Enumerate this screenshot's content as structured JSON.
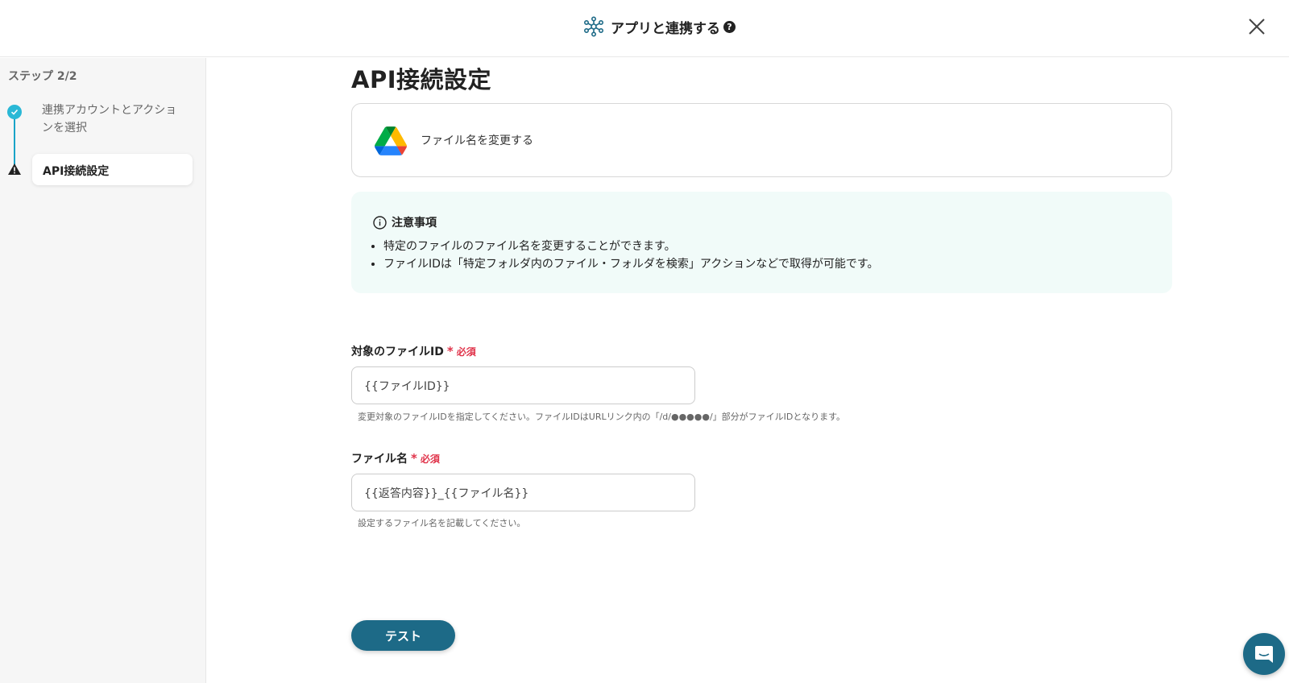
{
  "header": {
    "title": "アプリと連携する",
    "help_icon": "question-circle-icon",
    "close_icon": "close-icon",
    "app_icon": "network-hub-icon"
  },
  "sidebar": {
    "step_indicator": "ステップ 2/2",
    "steps": [
      {
        "label": "連携アカウントとアクションを選択",
        "status": "complete",
        "icon": "check-circle-icon"
      },
      {
        "label": "API接続設定",
        "status": "warning",
        "icon": "warning-triangle-icon",
        "active": true
      }
    ]
  },
  "main": {
    "title": "API接続設定",
    "action": {
      "icon": "google-drive-icon",
      "label": "ファイル名を変更する"
    },
    "notice": {
      "heading": "注意事項",
      "icon": "info-circle-icon",
      "items": [
        "特定のファイルのファイル名を変更することができます。",
        "ファイルIDは「特定フォルダ内のファイル・フォルダを検索」アクションなどで取得が可能です。"
      ]
    },
    "fields": [
      {
        "label": "対象のファイルID",
        "required_mark": "*",
        "required_text": "必須",
        "value": "{{ファイルID}}",
        "help": "変更対象のファイルIDを指定してください。ファイルIDはURLリンク内の「/d/●●●●●/」部分がファイルIDとなります。"
      },
      {
        "label": "ファイル名",
        "required_mark": "*",
        "required_text": "必須",
        "value": "{{返答内容}}_{{ファイル名}}",
        "help": "設定するファイル名を記載してください。"
      }
    ],
    "test_button": "テスト"
  },
  "chat_widget": {
    "icon": "chat-bubble-icon"
  },
  "colors": {
    "accent": "#1d6a87",
    "step_complete": "#2ab8d6",
    "required": "#e0334a",
    "notice_bg": "#f1fbf9"
  }
}
